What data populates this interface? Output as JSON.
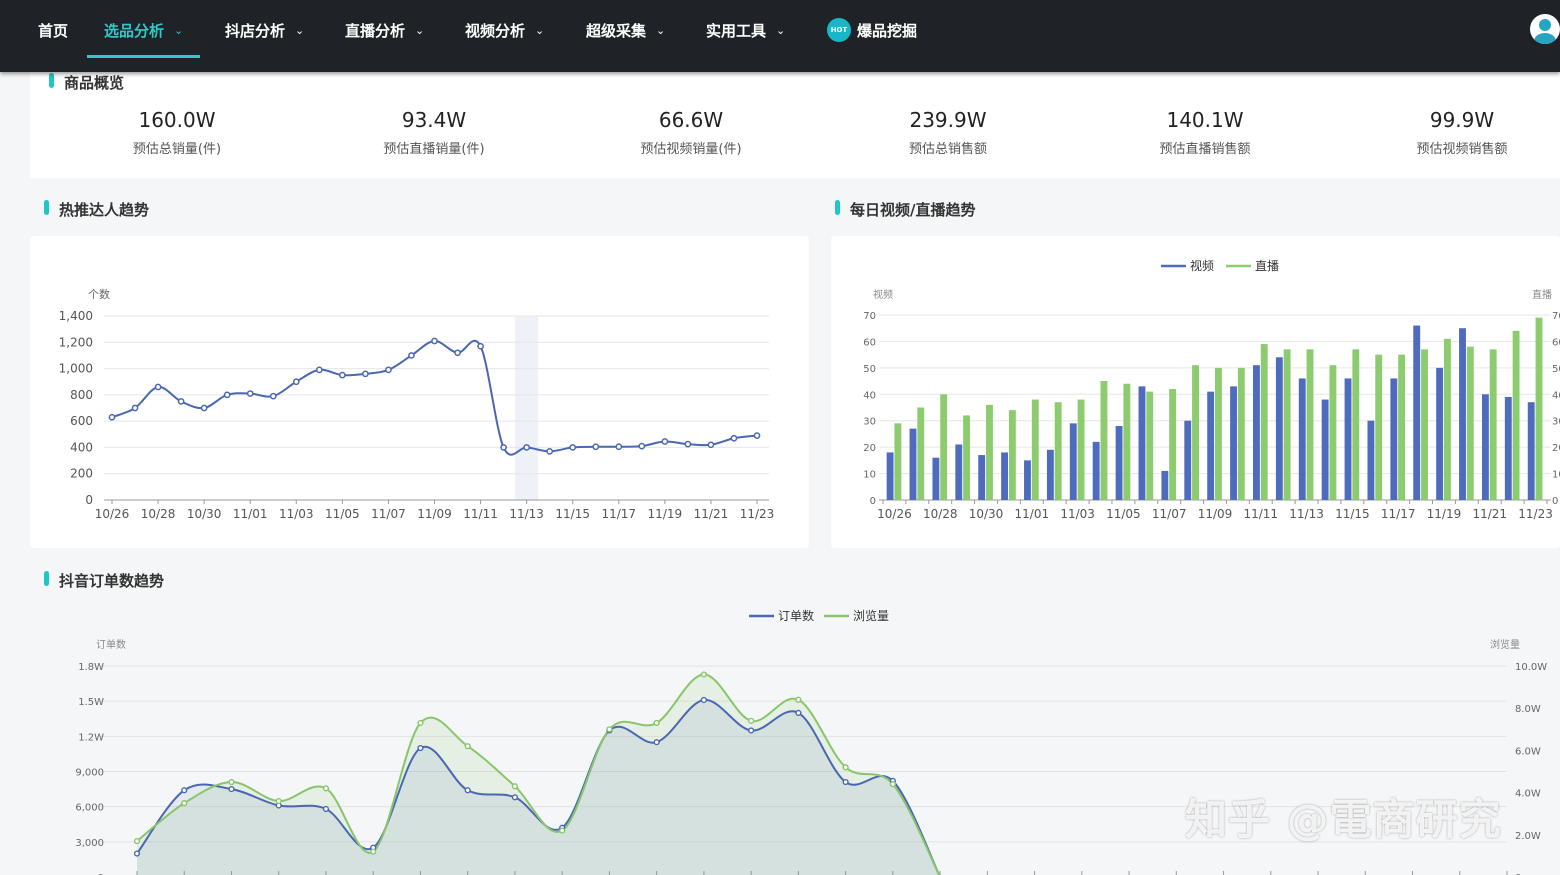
{
  "nav": {
    "items": [
      {
        "label": "首页",
        "dropdown": false
      },
      {
        "label": "选品分析",
        "dropdown": true,
        "active": true
      },
      {
        "label": "抖店分析",
        "dropdown": true
      },
      {
        "label": "直播分析",
        "dropdown": true
      },
      {
        "label": "视频分析",
        "dropdown": true
      },
      {
        "label": "超级采集",
        "dropdown": true
      },
      {
        "label": "实用工具",
        "dropdown": true
      }
    ],
    "hot_badge": "HOT",
    "hot_label": "爆品挖掘",
    "chevron": "⌄",
    "icons": {
      "hot": "flame-hot-icon",
      "avatar": "user-avatar-icon"
    },
    "accent_color": "#2fc9c9"
  },
  "overview": {
    "title": "商品概览",
    "stats": [
      {
        "value": "160.0W",
        "label": "预估总销量(件)"
      },
      {
        "value": "93.4W",
        "label": "预估直播销量(件)"
      },
      {
        "value": "66.6W",
        "label": "预估视频销量(件)"
      },
      {
        "value": "239.9W",
        "label": "预估总销售额"
      },
      {
        "value": "140.1W",
        "label": "预估直播销售额"
      },
      {
        "value": "99.9W",
        "label": "预估视频销售额"
      }
    ]
  },
  "sections": {
    "talent": "热推达人趋势",
    "daily": "每日视频/直播趋势",
    "orders": "抖音订单数趋势"
  },
  "watermark": "知乎 @電商研究",
  "chart_data": [
    {
      "type": "line",
      "title": "热推达人趋势",
      "ylabel": "个数",
      "ylim": [
        0,
        1400
      ],
      "yticks": [
        "0",
        "200",
        "400",
        "600",
        "800",
        "1,000",
        "1,200",
        "1,400"
      ],
      "x": [
        "10/26",
        "10/27",
        "10/28",
        "10/29",
        "10/30",
        "10/31",
        "11/01",
        "11/02",
        "11/03",
        "11/04",
        "11/05",
        "11/06",
        "11/07",
        "11/08",
        "11/09",
        "11/10",
        "11/11",
        "11/12",
        "11/13",
        "11/14",
        "11/15",
        "11/16",
        "11/17",
        "11/18",
        "11/19",
        "11/20",
        "11/21",
        "11/22",
        "11/23"
      ],
      "xticks": [
        "10/26",
        "10/28",
        "10/30",
        "11/01",
        "11/03",
        "11/05",
        "11/07",
        "11/09",
        "11/11",
        "11/13",
        "11/15",
        "11/17",
        "11/19",
        "11/21",
        "11/23"
      ],
      "values": [
        630,
        700,
        860,
        750,
        700,
        800,
        810,
        790,
        900,
        990,
        950,
        960,
        990,
        1100,
        1210,
        1120,
        1170,
        400,
        400,
        370,
        400,
        405,
        405,
        410,
        445,
        425,
        420,
        470,
        490
      ],
      "highlight": "11/13",
      "color": "#4a67b3"
    },
    {
      "type": "bar",
      "title": "每日视频/直播趋势",
      "ylabel": "视频",
      "y2label": "直播",
      "ylim": [
        0,
        70
      ],
      "yticks": [
        "0",
        "10",
        "20",
        "30",
        "40",
        "50",
        "60",
        "70"
      ],
      "x": [
        "10/26",
        "10/27",
        "10/28",
        "10/29",
        "10/30",
        "10/31",
        "11/01",
        "11/02",
        "11/03",
        "11/04",
        "11/05",
        "11/06",
        "11/07",
        "11/08",
        "11/09",
        "11/10",
        "11/11",
        "11/12",
        "11/13",
        "11/14",
        "11/15",
        "11/16",
        "11/17",
        "11/18",
        "11/19",
        "11/20",
        "11/21",
        "11/22",
        "11/23"
      ],
      "xticks": [
        "10/26",
        "10/28",
        "10/30",
        "11/01",
        "11/03",
        "11/05",
        "11/07",
        "11/09",
        "11/11",
        "11/13",
        "11/15",
        "11/17",
        "11/19",
        "11/21",
        "11/23"
      ],
      "series": [
        {
          "name": "视频",
          "color": "#4f6bbd",
          "values": [
            18,
            27,
            16,
            21,
            17,
            18,
            15,
            19,
            29,
            22,
            28,
            43,
            11,
            30,
            41,
            43,
            51,
            54,
            46,
            38,
            46,
            30,
            46,
            66,
            50,
            65,
            40,
            39,
            37
          ]
        },
        {
          "name": "直播",
          "color": "#8ccb6e",
          "values": [
            29,
            35,
            40,
            32,
            36,
            34,
            38,
            37,
            38,
            45,
            44,
            41,
            42,
            51,
            50,
            50,
            59,
            57,
            57,
            51,
            57,
            55,
            55,
            57,
            61,
            58,
            57,
            64,
            69
          ]
        }
      ],
      "legend": "top-center"
    },
    {
      "type": "area",
      "title": "抖音订单数趋势",
      "ylabel": "订单数",
      "y2label": "浏览量",
      "yticks": [
        "0",
        "3,000",
        "6,000",
        "9,000",
        "1.2W",
        "1.5W",
        "1.8W"
      ],
      "y2ticks": [
        "0",
        "2.0W",
        "4.0W",
        "6.0W",
        "8.0W",
        "10.0W"
      ],
      "x_count": 30,
      "series": [
        {
          "name": "订单数",
          "color": "#4a67b3",
          "values": [
            2000,
            7400,
            7500,
            6100,
            5800,
            2500,
            11000,
            7400,
            6800,
            4200,
            12500,
            11500,
            15100,
            12500,
            14000,
            8100,
            8200,
            0
          ]
        },
        {
          "name": "浏览量",
          "color": "#88c56b",
          "values": [
            17000,
            35000,
            45000,
            36000,
            42000,
            12000,
            73000,
            62000,
            43000,
            22000,
            70000,
            73000,
            96000,
            74000,
            84000,
            52000,
            44000,
            0
          ]
        }
      ],
      "legend": "top-center"
    }
  ]
}
